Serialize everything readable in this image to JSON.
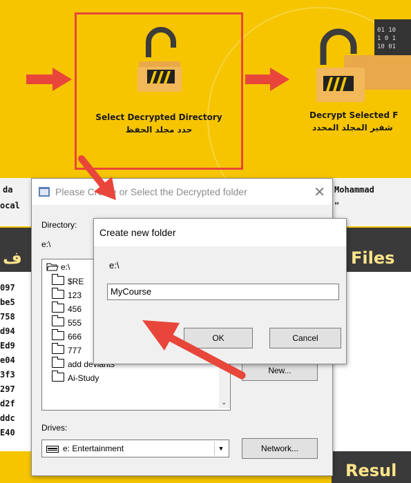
{
  "steps": [
    {
      "title": "Select Decrypted Directory",
      "subtitle": "حدد مجلد الحفظ"
    },
    {
      "title": "Decrypt Selected F",
      "subtitle": "شفير المجلد المحدد"
    }
  ],
  "background": {
    "name_fragment": "Mohammad",
    "left_row1": "da",
    "left_row2": "ocal",
    "right_row2": "\"",
    "band1_left": "ف",
    "band1_right": "Files",
    "band2_right": "Resul",
    "hash_fragments": [
      "097",
      "be5",
      "758",
      "d94",
      "Ed9",
      "e04",
      "3f3",
      "297",
      "d2f",
      "ddc",
      "E40"
    ]
  },
  "dialog": {
    "title": "Please Create or Select the Decrypted folder",
    "directory_label": "Directory:",
    "directory_value": "e:\\",
    "folders": [
      "e:\\",
      "$RE",
      "123",
      "456",
      "555",
      "666",
      "777",
      "add deviants",
      "Ai-Study"
    ],
    "drives_label": "Drives:",
    "drive_value": "e: Entertainment",
    "new_button": "New...",
    "network_button": "Network..."
  },
  "new_folder_dialog": {
    "title": "Create new folder",
    "path": "e:\\",
    "input_value": "MyCourse",
    "ok_button": "OK",
    "cancel_button": "Cancel"
  },
  "colors": {
    "background": "#f6c500",
    "highlight_border": "#e8463a",
    "annotation_arrow": "#e8463a",
    "band": "#3a3a3a"
  }
}
